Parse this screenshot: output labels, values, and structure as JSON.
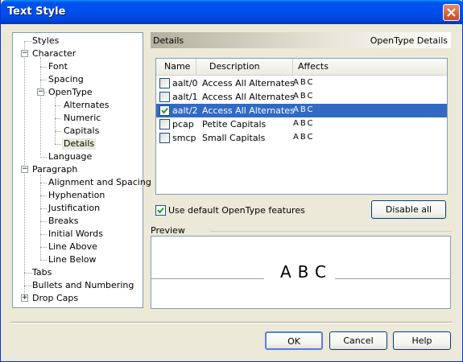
{
  "window": {
    "title": "Text Style",
    "close_icon": "close-icon"
  },
  "tree": {
    "items": [
      {
        "label": "Styles"
      },
      {
        "label": "Character"
      },
      {
        "label": "Font"
      },
      {
        "label": "Spacing"
      },
      {
        "label": "OpenType"
      },
      {
        "label": "Alternates"
      },
      {
        "label": "Numeric"
      },
      {
        "label": "Capitals"
      },
      {
        "label": "Details"
      },
      {
        "label": "Language"
      },
      {
        "label": "Paragraph"
      },
      {
        "label": "Alignment and Spacing"
      },
      {
        "label": "Hyphenation"
      },
      {
        "label": "Justification"
      },
      {
        "label": "Breaks"
      },
      {
        "label": "Initial Words"
      },
      {
        "label": "Line Above"
      },
      {
        "label": "Line Below"
      },
      {
        "label": "Tabs"
      },
      {
        "label": "Bullets and Numbering"
      },
      {
        "label": "Drop Caps"
      }
    ]
  },
  "details": {
    "header_left": "Details",
    "header_right": "OpenType Details",
    "columns": [
      "Name",
      "Description",
      "Affects"
    ],
    "rows": [
      {
        "checked": false,
        "name": "aalt/0",
        "description": "Access All Alternates",
        "affects": "ABC"
      },
      {
        "checked": false,
        "name": "aalt/1",
        "description": "Access All Alternates",
        "affects": "ABC"
      },
      {
        "checked": true,
        "name": "aalt/2",
        "description": "Access All Alternates",
        "affects": "ABC"
      },
      {
        "checked": false,
        "name": "pcap",
        "description": "Petite Capitals",
        "affects": "ABC"
      },
      {
        "checked": false,
        "name": "smcp",
        "description": "Small Capitals",
        "affects": "ABC"
      }
    ],
    "use_default_label": "Use default OpenType features",
    "use_default_checked": true,
    "disable_all_label": "Disable all"
  },
  "preview": {
    "label": "Preview",
    "sample": "ABC"
  },
  "buttons": {
    "ok": "OK",
    "cancel": "Cancel",
    "help": "Help"
  }
}
